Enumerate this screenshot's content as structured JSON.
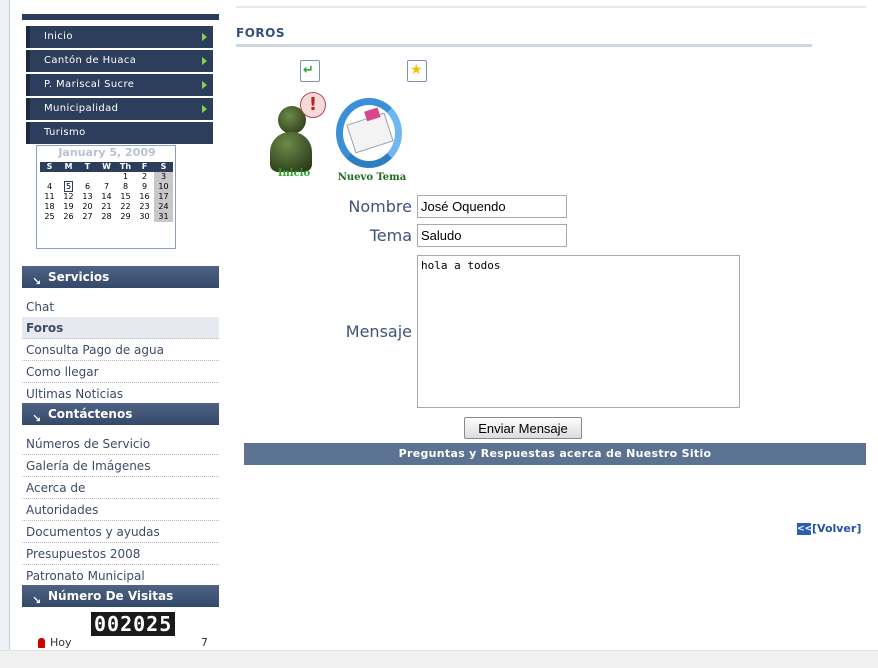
{
  "nav_menu": [
    {
      "label": "Inicio",
      "has_arrow": true
    },
    {
      "label": "Cantón de Huaca",
      "has_arrow": true
    },
    {
      "label": "P. Mariscal Sucre",
      "has_arrow": true
    },
    {
      "label": "Municipalidad",
      "has_arrow": true
    },
    {
      "label": "Turismo",
      "has_arrow": false
    }
  ],
  "calendar": {
    "title": "January 5, 2009",
    "weekdays": [
      "S",
      "M",
      "T",
      "W",
      "Th",
      "F",
      "S"
    ],
    "weeks": [
      [
        "",
        "",
        "",
        "",
        "1",
        "2",
        "3"
      ],
      [
        "4",
        "5",
        "6",
        "7",
        "8",
        "9",
        "10"
      ],
      [
        "11",
        "12",
        "13",
        "14",
        "15",
        "16",
        "17"
      ],
      [
        "18",
        "19",
        "20",
        "21",
        "22",
        "23",
        "24"
      ],
      [
        "25",
        "26",
        "27",
        "28",
        "29",
        "30",
        "31"
      ]
    ],
    "today": "5"
  },
  "sections": {
    "servicios": {
      "title": "Servicios",
      "items": [
        "Chat",
        "Foros",
        "Consulta Pago de agua",
        "Como llegar",
        "Ultimas Noticias"
      ],
      "active": "Foros"
    },
    "contactenos": {
      "title": "Contáctenos",
      "items": [
        "Números de Servicio",
        "Galería de Imágenes",
        "Acerca de",
        "Autoridades",
        "Documentos y ayudas",
        "Presupuestos 2008",
        "Patronato Municipal"
      ]
    },
    "visitas": {
      "title": "Número De Visitas",
      "counter": "002025",
      "hoy_label": "Hoy",
      "hoy_count": "7"
    }
  },
  "main": {
    "title": "FOROS",
    "inicio_label": "Inicio",
    "nuevo_tema_label": "Nuevo Tema",
    "form": {
      "nombre_label": "Nombre",
      "nombre_value": "José Oquendo",
      "tema_label": "Tema",
      "tema_value": "Saludo",
      "mensaje_label": "Mensaje",
      "mensaje_value": "hola a todos",
      "submit_label": "Enviar Mensaje"
    },
    "faq_bar": "Preguntas y Respuestas acerca de Nuestro Sitio",
    "volver_label": "[Volver]",
    "volver_icon": "<<"
  },
  "colors": {
    "nav_bg": "#2d3e5c",
    "nav_arrow": "#8bd14a",
    "section_header": "#34486a",
    "faq_bar": "#5c7291",
    "title": "#34507a"
  }
}
